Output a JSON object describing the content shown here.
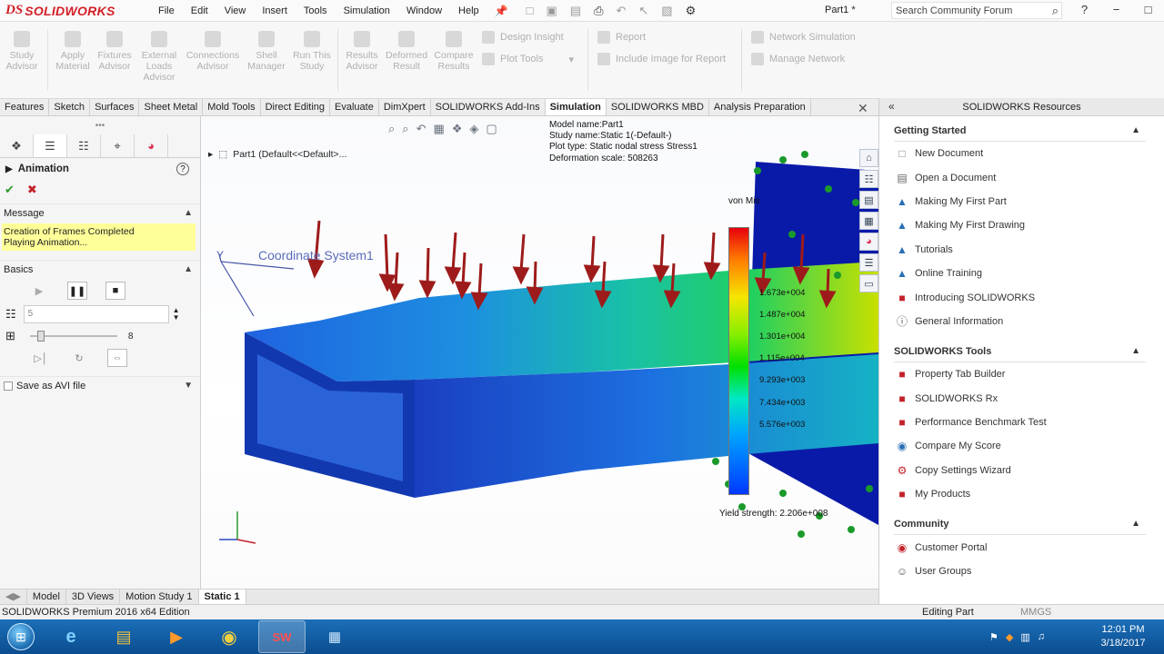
{
  "app": {
    "brand_prefix": "DS",
    "brand_name": "SOLIDWORKS"
  },
  "menu": [
    "File",
    "Edit",
    "View",
    "Insert",
    "Tools",
    "Simulation",
    "Window",
    "Help"
  ],
  "document_title": "Part1 *",
  "search": {
    "placeholder": "Search Community Forum"
  },
  "command_manager": {
    "buttons": [
      {
        "label": "Study Advisor",
        "icon": "study-advisor-icon"
      },
      {
        "label": "Apply Material",
        "icon": "material-icon"
      },
      {
        "label": "Fixtures Advisor",
        "icon": "fixtures-icon"
      },
      {
        "label": "External Loads Advisor",
        "icon": "loads-icon"
      },
      {
        "label": "Connections Advisor",
        "icon": "connections-icon"
      },
      {
        "label": "Shell Manager",
        "icon": "shell-icon"
      },
      {
        "label": "Run This Study",
        "icon": "run-icon"
      },
      {
        "label": "Results Advisor",
        "icon": "results-icon"
      },
      {
        "label": "Deformed Result",
        "icon": "deformed-icon"
      },
      {
        "label": "Compare Results",
        "icon": "compare-icon"
      }
    ],
    "list1": [
      "Design Insight",
      "Plot Tools"
    ],
    "list2": [
      "Report",
      "Include Image for Report"
    ],
    "list3": [
      "Network Simulation",
      "Manage Network"
    ]
  },
  "tabs": [
    "Features",
    "Sketch",
    "Surfaces",
    "Sheet Metal",
    "Mold Tools",
    "Direct Editing",
    "Evaluate",
    "DimXpert",
    "SOLIDWORKS Add-Ins",
    "Simulation",
    "SOLIDWORKS MBD",
    "Analysis Preparation"
  ],
  "active_tab": "Simulation",
  "property_manager": {
    "title": "Animation",
    "message_header": "Message",
    "message_line1": "Creation of Frames Completed",
    "message_line2": "Playing Animation...",
    "basics_header": "Basics",
    "frames_value": "5",
    "slider_value_label": "8",
    "save_avi_label": "Save as AVI file"
  },
  "graphics": {
    "tree_node": "Part1  (Default<<Default>...",
    "plot_info": {
      "model": "Model name:Part1",
      "study": "Study name:Static 1(-Default-)",
      "plot": "Plot type: Static nodal stress Stress1",
      "scale": "Deformation scale: 508263"
    },
    "legend_title": "von Mis",
    "legend_ticks": [
      "1.673e+004",
      "1.487e+004",
      "1.301e+004",
      "1.115e+004",
      "9.293e+003",
      "7.434e+003",
      "5.576e+003"
    ],
    "yield_label": "Yield strength: 2.206e+008",
    "coord_label": "Coordinate System1"
  },
  "bottom_tabs": [
    "Model",
    "3D Views",
    "Motion Study 1",
    "Static 1"
  ],
  "active_bottom_tab": "Static 1",
  "status": {
    "left": "SOLIDWORKS Premium 2016 x64 Edition",
    "editing": "Editing Part",
    "units": "MMGS"
  },
  "task_pane": {
    "title": "SOLIDWORKS Resources",
    "sections": [
      {
        "title": "Getting Started",
        "items": [
          "New Document",
          "Open a Document",
          "Making My First Part",
          "Making My First Drawing",
          "Tutorials",
          "Online Training",
          "Introducing SOLIDWORKS",
          "General Information"
        ]
      },
      {
        "title": "SOLIDWORKS Tools",
        "items": [
          "Property Tab Builder",
          "SOLIDWORKS Rx",
          "Performance Benchmark Test",
          "Compare My Score",
          "Copy Settings Wizard",
          "My Products"
        ]
      },
      {
        "title": "Community",
        "items": [
          "Customer Portal",
          "User Groups"
        ]
      }
    ]
  },
  "taskbar": {
    "time": "12:01 PM",
    "date": "3/18/2017"
  },
  "colors": {
    "brand_red": "#d32027",
    "highlight_yellow": "#ffff99",
    "taskbar_blue": "#1b6fb8"
  }
}
